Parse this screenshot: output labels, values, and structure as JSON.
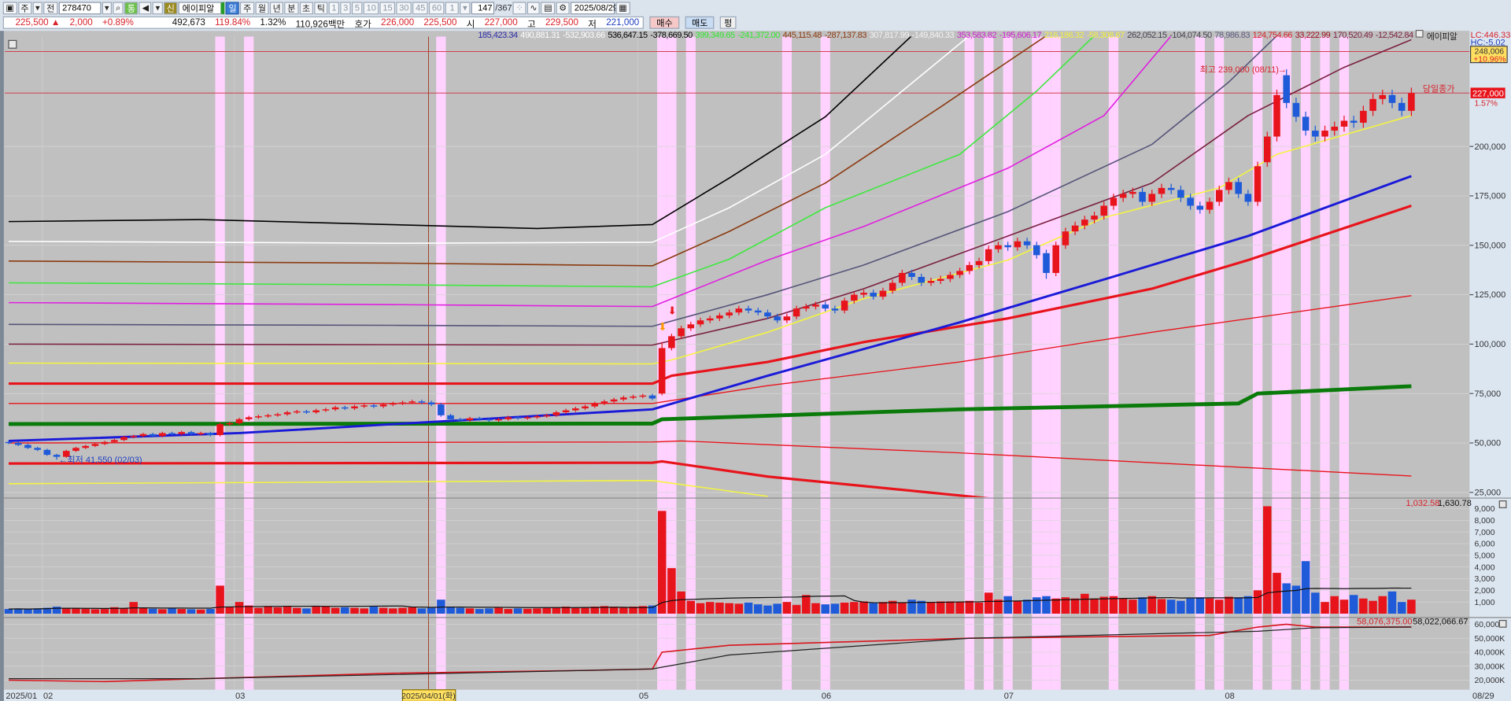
{
  "toolbar": {
    "period_type": "주",
    "all_label": "전",
    "code": "278470",
    "tong_label": "통",
    "sin_label": "신",
    "stock_name": "에이피알",
    "tabs": [
      "일",
      "주",
      "월",
      "년",
      "분",
      "초",
      "틱"
    ],
    "selected_tab": "일",
    "intervals": [
      "1",
      "3",
      "5",
      "10",
      "15",
      "30",
      "45",
      "60"
    ],
    "multiplier": "1",
    "count": "147",
    "total": "/367",
    "date": "2025/08/29"
  },
  "quote_bar": {
    "price": "225,500 ▲",
    "change": "2,000",
    "change_pct": "+0.89%",
    "volume": "492,673",
    "volume_ratio": "119.84%",
    "turnover": "1.32%",
    "amount": "110,926백만",
    "ask_label": "호가",
    "ask1": "226,000",
    "ask2": "225,500",
    "open_label": "시",
    "open": "227,000",
    "high_label": "고",
    "high": "229,500",
    "low_label": "저",
    "low": "221,000",
    "buy_label": "매수",
    "sell_label": "매도",
    "pyeong_label": "펑"
  },
  "legend": {
    "values": [
      {
        "text": "185,423.34",
        "color": "#2a2aa8"
      },
      {
        "text": "490,881.31",
        "color": "#ffffff"
      },
      {
        "text": "-532,903.66",
        "color": "#ffffff"
      },
      {
        "text": "536,647.15",
        "color": "#000000"
      },
      {
        "text": "-378,669.50",
        "color": "#000000"
      },
      {
        "text": "399,349.65",
        "color": "#2ee82e"
      },
      {
        "text": "-241,372.00",
        "color": "#2ee82e"
      },
      {
        "text": "445,115.48",
        "color": "#8b3a10"
      },
      {
        "text": "-287,137.83",
        "color": "#8b3a10"
      },
      {
        "text": "307,817.99",
        "color": "#f4f4f4"
      },
      {
        "text": "-149,840.33",
        "color": "#f4f4f4"
      },
      {
        "text": "353,583.82",
        "color": "#d020d0"
      },
      {
        "text": "-195,606.17",
        "color": "#d020d0"
      },
      {
        "text": "216,186.32",
        "color": "#f0f040"
      },
      {
        "text": "-58,308.67",
        "color": "#f0f040"
      },
      {
        "text": "262,052.15",
        "color": "#404050"
      },
      {
        "text": "-104,074.50",
        "color": "#404050"
      },
      {
        "text": "78,986.83",
        "color": "#5a5a80"
      },
      {
        "text": "124,754.66",
        "color": "#d8222a"
      },
      {
        "text": "33,222.99",
        "color": "#a01020"
      },
      {
        "text": "170,520.49",
        "color": "#7a2040"
      },
      {
        "text": "-12,542.84",
        "color": "#7a2040"
      }
    ],
    "name": "에이피알"
  },
  "right_labels": {
    "lc": "LC:446.33",
    "hc": "HC:-5.02",
    "target_price": "248,006",
    "target_pct": "+10.96%",
    "close_price": "227,000",
    "close_pct": "1.57%",
    "close_line_label": "당일종가",
    "volume_ma_values": [
      "1,032.58",
      "1,630.78"
    ],
    "amount_ma_values": [
      "58,076,375.00",
      "58,022,066.67"
    ]
  },
  "chart_data": {
    "type": "candlestick",
    "title": "에이피알",
    "close": [
      50000,
      49000,
      47500,
      46500,
      44000,
      43000,
      46000,
      47500,
      48500,
      49500,
      50500,
      51500,
      53000,
      53500,
      54500,
      53500,
      55000,
      54500,
      55500,
      54500,
      55000,
      54000,
      59500,
      60000,
      62000,
      63000,
      63500,
      64000,
      64500,
      65500,
      66000,
      65500,
      66500,
      67000,
      68000,
      67500,
      68500,
      69000,
      68500,
      69500,
      70000,
      70500,
      71000,
      70500,
      69500,
      64000,
      62000,
      61500,
      62500,
      62000,
      61500,
      62000,
      63000,
      62500,
      63000,
      63500,
      64000,
      65500,
      66500,
      67500,
      68500,
      70000,
      71000,
      72000,
      73000,
      73500,
      74000,
      72500,
      98000,
      104000,
      108000,
      110000,
      112000,
      113000,
      114500,
      116000,
      118000,
      117000,
      116000,
      114000,
      112000,
      114000,
      118000,
      119000,
      120000,
      118000,
      117000,
      122000,
      125000,
      126000,
      124000,
      127000,
      131000,
      136000,
      134000,
      131000,
      132000,
      133000,
      135000,
      137000,
      140000,
      142000,
      148000,
      150000,
      149000,
      152000,
      150000,
      145000,
      136000,
      150000,
      157000,
      160000,
      163000,
      165000,
      170000,
      174000,
      176000,
      177000,
      172000,
      176000,
      179000,
      178000,
      174000,
      170000,
      168000,
      172000,
      178000,
      182000,
      176000,
      172000,
      190000,
      205000,
      226000,
      222000,
      215000,
      208000,
      205000,
      208000,
      210000,
      213000,
      212000,
      218000,
      224000,
      226000,
      222000,
      218000,
      227000
    ],
    "overrides": {
      "5": {
        "low": 41550
      },
      "68": {
        "open": 75000,
        "high": 101000
      },
      "108": {
        "open": 146000,
        "low": 133000
      },
      "131": {
        "open": 192000
      },
      "133": {
        "open": 236000,
        "high": 239000
      }
    },
    "volume": [
      400,
      420,
      380,
      450,
      500,
      600,
      500,
      450,
      420,
      380,
      400,
      550,
      450,
      1000,
      500,
      420,
      380,
      450,
      400,
      380,
      350,
      400,
      2400,
      600,
      1000,
      700,
      500,
      650,
      550,
      600,
      500,
      450,
      600,
      650,
      500,
      550,
      500,
      450,
      600,
      500,
      450,
      500,
      550,
      450,
      500,
      1200,
      600,
      500,
      450,
      400,
      450,
      500,
      400,
      450,
      420,
      450,
      500,
      550,
      600,
      500,
      550,
      600,
      650,
      600,
      550,
      600,
      650,
      700,
      8800,
      3900,
      1900,
      1100,
      900,
      1000,
      950,
      900,
      850,
      950,
      800,
      700,
      850,
      1000,
      750,
      1600,
      900,
      800,
      850,
      950,
      1000,
      1050,
      900,
      1000,
      1100,
      950,
      1200,
      1100,
      1000,
      1050,
      1050,
      1000,
      1100,
      950,
      1800,
      1200,
      1500,
      1100,
      1200,
      1400,
      1500,
      1300,
      1400,
      1300,
      1700,
      1300,
      1450,
      1500,
      1300,
      1200,
      1400,
      1500,
      1250,
      1200,
      1100,
      1300,
      1400,
      1300,
      1200,
      1450,
      1400,
      1500,
      2000,
      9200,
      3500,
      2600,
      2400,
      4500,
      1800,
      1000,
      1500,
      1200,
      1600,
      1300,
      1100,
      1500,
      1900,
      1000,
      1200
    ],
    "highlight_days": [
      22,
      25,
      45,
      68,
      69,
      71,
      81,
      85,
      100,
      102,
      104,
      107,
      108,
      109,
      115,
      124,
      126,
      130,
      132,
      133,
      135,
      137,
      139
    ],
    "lines": [
      {
        "name": "band-black",
        "color": "#000000",
        "width": 1.3,
        "points": [
          [
            0,
            162000
          ],
          [
            20,
            163000
          ],
          [
            55,
            158500
          ],
          [
            67,
            160500
          ],
          [
            75,
            184000
          ],
          [
            85,
            215000
          ],
          [
            94,
            256000
          ]
        ]
      },
      {
        "name": "band-white",
        "color": "#ffffff",
        "width": 1.3,
        "points": [
          [
            0,
            152000
          ],
          [
            40,
            151000
          ],
          [
            67,
            151500
          ],
          [
            75,
            169000
          ],
          [
            85,
            196000
          ],
          [
            100,
            256000
          ]
        ]
      },
      {
        "name": "band-brown",
        "color": "#8b3a10",
        "width": 1.3,
        "points": [
          [
            0,
            142000
          ],
          [
            40,
            141000
          ],
          [
            67,
            139600
          ],
          [
            75,
            157000
          ],
          [
            85,
            181500
          ],
          [
            97,
            220000
          ],
          [
            108,
            256000
          ]
        ]
      },
      {
        "name": "band-green",
        "color": "#3ee83e",
        "width": 1.3,
        "points": [
          [
            0,
            131000
          ],
          [
            40,
            130000
          ],
          [
            67,
            129000
          ],
          [
            75,
            143000
          ],
          [
            85,
            169000
          ],
          [
            99,
            196000
          ],
          [
            107,
            228000
          ],
          [
            113,
            256000
          ]
        ]
      },
      {
        "name": "band-magenta",
        "color": "#e020e0",
        "width": 1.3,
        "points": [
          [
            0,
            121000
          ],
          [
            40,
            120000
          ],
          [
            67,
            119000
          ],
          [
            79,
            142500
          ],
          [
            89,
            159500
          ],
          [
            104,
            189000
          ],
          [
            114,
            215600
          ],
          [
            121,
            256000
          ]
        ]
      },
      {
        "name": "band-slate",
        "color": "#55557a",
        "width": 1.3,
        "points": [
          [
            0,
            110000
          ],
          [
            40,
            109500
          ],
          [
            67,
            109000
          ],
          [
            79,
            125000
          ],
          [
            89,
            140000
          ],
          [
            104,
            167000
          ],
          [
            119,
            201000
          ],
          [
            127,
            232600
          ],
          [
            132,
            256000
          ]
        ]
      },
      {
        "name": "band-maroon",
        "color": "#7a2040",
        "width": 1.3,
        "points": [
          [
            0,
            100000
          ],
          [
            67,
            99500
          ],
          [
            79,
            113000
          ],
          [
            89,
            128000
          ],
          [
            104,
            154700
          ],
          [
            119,
            181500
          ],
          [
            129,
            215600
          ],
          [
            139,
            240000
          ],
          [
            146,
            254000
          ]
        ]
      },
      {
        "name": "band-yellow",
        "color": "#f4f440",
        "width": 1.3,
        "points": [
          [
            0,
            90400
          ],
          [
            67,
            90000
          ],
          [
            69,
            92000
          ],
          [
            79,
            106000
          ],
          [
            89,
            123000
          ],
          [
            104,
            142500
          ],
          [
            114,
            164000
          ],
          [
            126,
            179000
          ],
          [
            132,
            196000
          ],
          [
            146,
            215600
          ]
        ]
      },
      {
        "name": "band-red-thick",
        "color": "#e8141c",
        "width": 2.6,
        "points": [
          [
            0,
            80000
          ],
          [
            67,
            80000
          ],
          [
            69,
            84000
          ],
          [
            79,
            91000
          ],
          [
            89,
            101000
          ],
          [
            104,
            113000
          ],
          [
            119,
            128000
          ],
          [
            129,
            142500
          ],
          [
            146,
            170000
          ]
        ]
      },
      {
        "name": "band-red-thin",
        "color": "#e8141c",
        "width": 1.1,
        "points": [
          [
            0,
            70000
          ],
          [
            67,
            70000
          ],
          [
            79,
            79000
          ],
          [
            99,
            91000
          ],
          [
            119,
            106000
          ],
          [
            146,
            124500
          ]
        ]
      },
      {
        "name": "ma-green",
        "color": "#0a7a0a",
        "width": 4,
        "points": [
          [
            0,
            59600
          ],
          [
            67,
            59800
          ],
          [
            68,
            62000
          ],
          [
            99,
            67000
          ],
          [
            128,
            70000
          ],
          [
            130,
            75000
          ],
          [
            146,
            78700
          ]
        ]
      },
      {
        "name": "ma-blue",
        "color": "#1a1ad8",
        "width": 2.4,
        "points": [
          [
            0,
            51000
          ],
          [
            24,
            55000
          ],
          [
            44,
            60600
          ],
          [
            67,
            67000
          ],
          [
            79,
            84000
          ],
          [
            99,
            111000
          ],
          [
            114,
            132700
          ],
          [
            129,
            154700
          ],
          [
            146,
            185000
          ]
        ]
      },
      {
        "name": "band-red-low-thin",
        "color": "#e8141c",
        "width": 1.1,
        "points": [
          [
            0,
            50000
          ],
          [
            67,
            50500
          ],
          [
            70,
            51000
          ],
          [
            99,
            45000
          ],
          [
            146,
            33300
          ]
        ]
      },
      {
        "name": "band-red-low-thick",
        "color": "#e8141c",
        "width": 2.6,
        "points": [
          [
            0,
            39600
          ],
          [
            67,
            40000
          ],
          [
            68,
            40700
          ],
          [
            79,
            33000
          ],
          [
            102,
            22000
          ]
        ]
      },
      {
        "name": "band-yellow-low",
        "color": "#f4f440",
        "width": 1.3,
        "points": [
          [
            0,
            29400
          ],
          [
            67,
            31000
          ],
          [
            79,
            23000
          ]
        ]
      }
    ],
    "amount_lines": [
      {
        "name": "amount-ma-red",
        "color": "#d8141c",
        "width": 1.3,
        "points": [
          [
            0,
            20000
          ],
          [
            10,
            19000
          ],
          [
            20,
            21000
          ],
          [
            40,
            25000
          ],
          [
            60,
            27000
          ],
          [
            67,
            28000
          ],
          [
            68,
            40000
          ],
          [
            75,
            45000
          ],
          [
            100,
            50000
          ],
          [
            125,
            52000
          ],
          [
            130,
            58000
          ],
          [
            133,
            60000
          ],
          [
            136,
            58000
          ],
          [
            146,
            58076
          ]
        ]
      },
      {
        "name": "amount-ma-black",
        "color": "#222222",
        "width": 1,
        "points": [
          [
            0,
            21000
          ],
          [
            20,
            21000
          ],
          [
            67,
            28000
          ],
          [
            75,
            38000
          ],
          [
            100,
            50000
          ],
          [
            130,
            55000
          ],
          [
            136,
            57500
          ],
          [
            146,
            58022
          ]
        ]
      }
    ],
    "price_ticks": [
      {
        "label": "200,000",
        "value": 200000
      },
      {
        "label": "175,000",
        "value": 175000
      },
      {
        "label": "150,000",
        "value": 150000
      },
      {
        "label": "125,000",
        "value": 125000
      },
      {
        "label": "100,000",
        "value": 100000
      },
      {
        "label": "75,000",
        "value": 75000
      },
      {
        "label": "50,000",
        "value": 50000
      },
      {
        "label": "25,000",
        "value": 25000
      }
    ],
    "volume_ticks": [
      {
        "label": "9,000",
        "value": 9000
      },
      {
        "label": "8,000",
        "value": 8000
      },
      {
        "label": "7,000",
        "value": 7000
      },
      {
        "label": "6,000",
        "value": 6000
      },
      {
        "label": "5,000",
        "value": 5000
      },
      {
        "label": "4,000",
        "value": 4000
      },
      {
        "label": "3,000",
        "value": 3000
      },
      {
        "label": "2,000",
        "value": 2000
      },
      {
        "label": "1,000",
        "value": 1000
      }
    ],
    "amount_ticks": [
      {
        "label": "60,000K",
        "value": 60000
      },
      {
        "label": "50,000K",
        "value": 50000
      },
      {
        "label": "40,000K",
        "value": 40000
      },
      {
        "label": "30,000K",
        "value": 30000
      },
      {
        "label": "20,000K",
        "value": 20000
      }
    ],
    "date_labels": [
      {
        "label": "2025/01",
        "index": 0
      },
      {
        "label": "02",
        "index": 4
      },
      {
        "label": "03",
        "index": 24
      },
      {
        "label": "05",
        "index": 66
      },
      {
        "label": "06",
        "index": 85
      },
      {
        "label": "07",
        "index": 104
      },
      {
        "label": "08",
        "index": 127
      }
    ],
    "last_date_label": "08/29",
    "crosshair": {
      "label": "2025/04/01(화)",
      "index": 44
    },
    "reference_lines": [
      {
        "value": 248006,
        "label": "target"
      },
      {
        "value": 227000,
        "label": "당일종가"
      }
    ],
    "annotations": {
      "high": {
        "text": "최고 239,000 (08/11)",
        "index": 133,
        "value": 239000
      },
      "low": {
        "text": "최저 41,550 (02/03)",
        "index": 5,
        "value": 41550
      }
    }
  }
}
